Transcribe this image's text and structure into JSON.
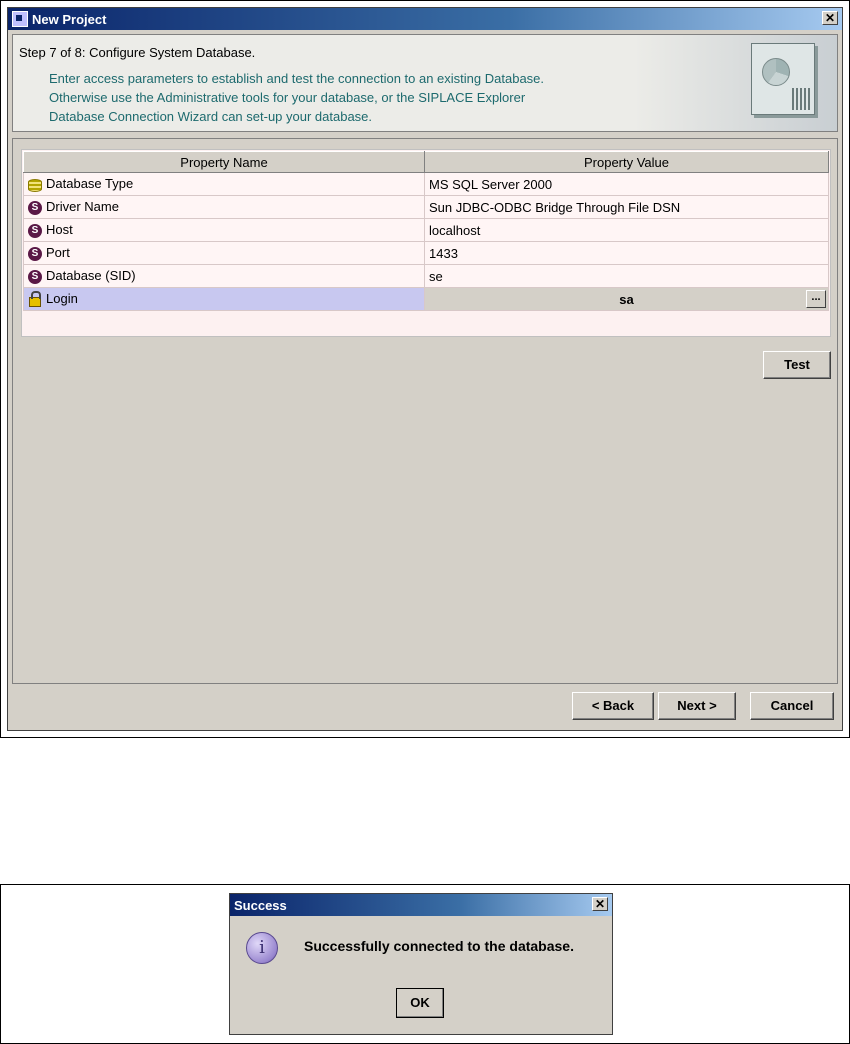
{
  "wizard": {
    "title": "New Project",
    "close_label": "✕",
    "step": "Step 7 of 8: Configure System Database.",
    "description_lines": [
      "Enter access parameters to establish and test the connection to an existing Database.",
      "Otherwise use the Administrative tools for your database, or the SIPLACE Explorer",
      "Database Connection Wizard can set-up your database."
    ],
    "table": {
      "headers": [
        "Property Name",
        "Property Value"
      ],
      "rows": [
        {
          "name": "Database Type",
          "value": "MS SQL Server 2000",
          "icon": "database-icon"
        },
        {
          "name": "Driver Name",
          "value": "Sun JDBC-ODBC Bridge Through File DSN",
          "icon": "s-icon"
        },
        {
          "name": "Host",
          "value": "localhost",
          "icon": "s-icon"
        },
        {
          "name": "Port",
          "value": "1433",
          "icon": "s-icon"
        },
        {
          "name": "Database (SID)",
          "value": "se",
          "icon": "s-icon"
        },
        {
          "name": "Login",
          "value": "sa",
          "icon": "lock-icon"
        }
      ],
      "ellipsis_label": "...",
      "selected_row": "Login"
    },
    "test_button": "Test",
    "back_button": "< Back",
    "next_button": "Next >",
    "cancel_button": "Cancel"
  },
  "success_dialog": {
    "title": "Success",
    "close_label": "✕",
    "message": "Successfully connected to the database.",
    "icon": "info-icon",
    "icon_glyph": "i",
    "ok_button": "OK"
  },
  "colors": {
    "title_bar_start": "#0a246a",
    "window_bg": "#d4d0c8",
    "description_text": "#1d6a6e",
    "selected_row": "#c8c8f0",
    "row_bg": "#fff5f5"
  }
}
